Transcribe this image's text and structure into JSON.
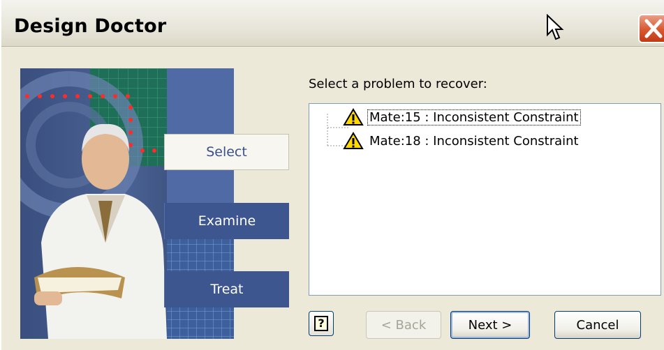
{
  "window": {
    "title": "Design Doctor"
  },
  "steps": [
    {
      "label": "Select",
      "active": true
    },
    {
      "label": "Examine",
      "active": false
    },
    {
      "label": "Treat",
      "active": false
    }
  ],
  "main": {
    "prompt": "Select a problem to recover:",
    "problems": [
      {
        "label": "Mate:15 : Inconsistent Constraint",
        "icon": "warning-icon",
        "selected": true
      },
      {
        "label": "Mate:18 : Inconsistent Constraint",
        "icon": "warning-icon",
        "selected": false
      }
    ]
  },
  "buttons": {
    "back": "< Back",
    "next": "Next >",
    "cancel": "Cancel"
  },
  "colors": {
    "step_active_text": "#3b4f8c",
    "step_inactive_bg": "#3e5690",
    "warning_yellow": "#ffd800"
  }
}
